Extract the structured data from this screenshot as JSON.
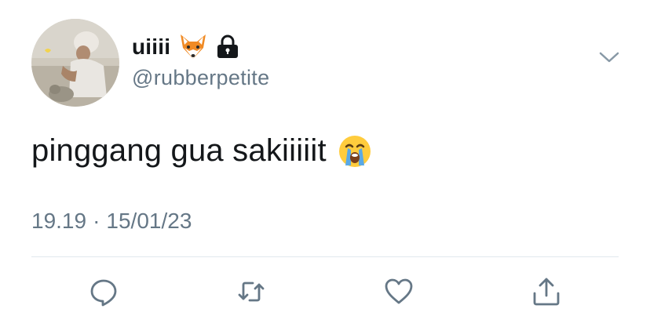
{
  "tweet": {
    "display_name": "uiiii",
    "name_emoji": "fox-face-emoji",
    "protected_icon": "lock-icon",
    "handle": "@rubberpetite",
    "text": "pinggang gua sakiiiiit",
    "text_emoji": "loudly-crying-face-emoji",
    "time": "19.19",
    "separator": "·",
    "date": "15/01/23"
  },
  "actions": [
    {
      "icon": "reply-icon"
    },
    {
      "icon": "retweet-icon"
    },
    {
      "icon": "like-icon"
    },
    {
      "icon": "share-icon"
    }
  ],
  "colors": {
    "text": "#14171a",
    "secondary": "#657786",
    "divider": "#e1e8ed"
  }
}
